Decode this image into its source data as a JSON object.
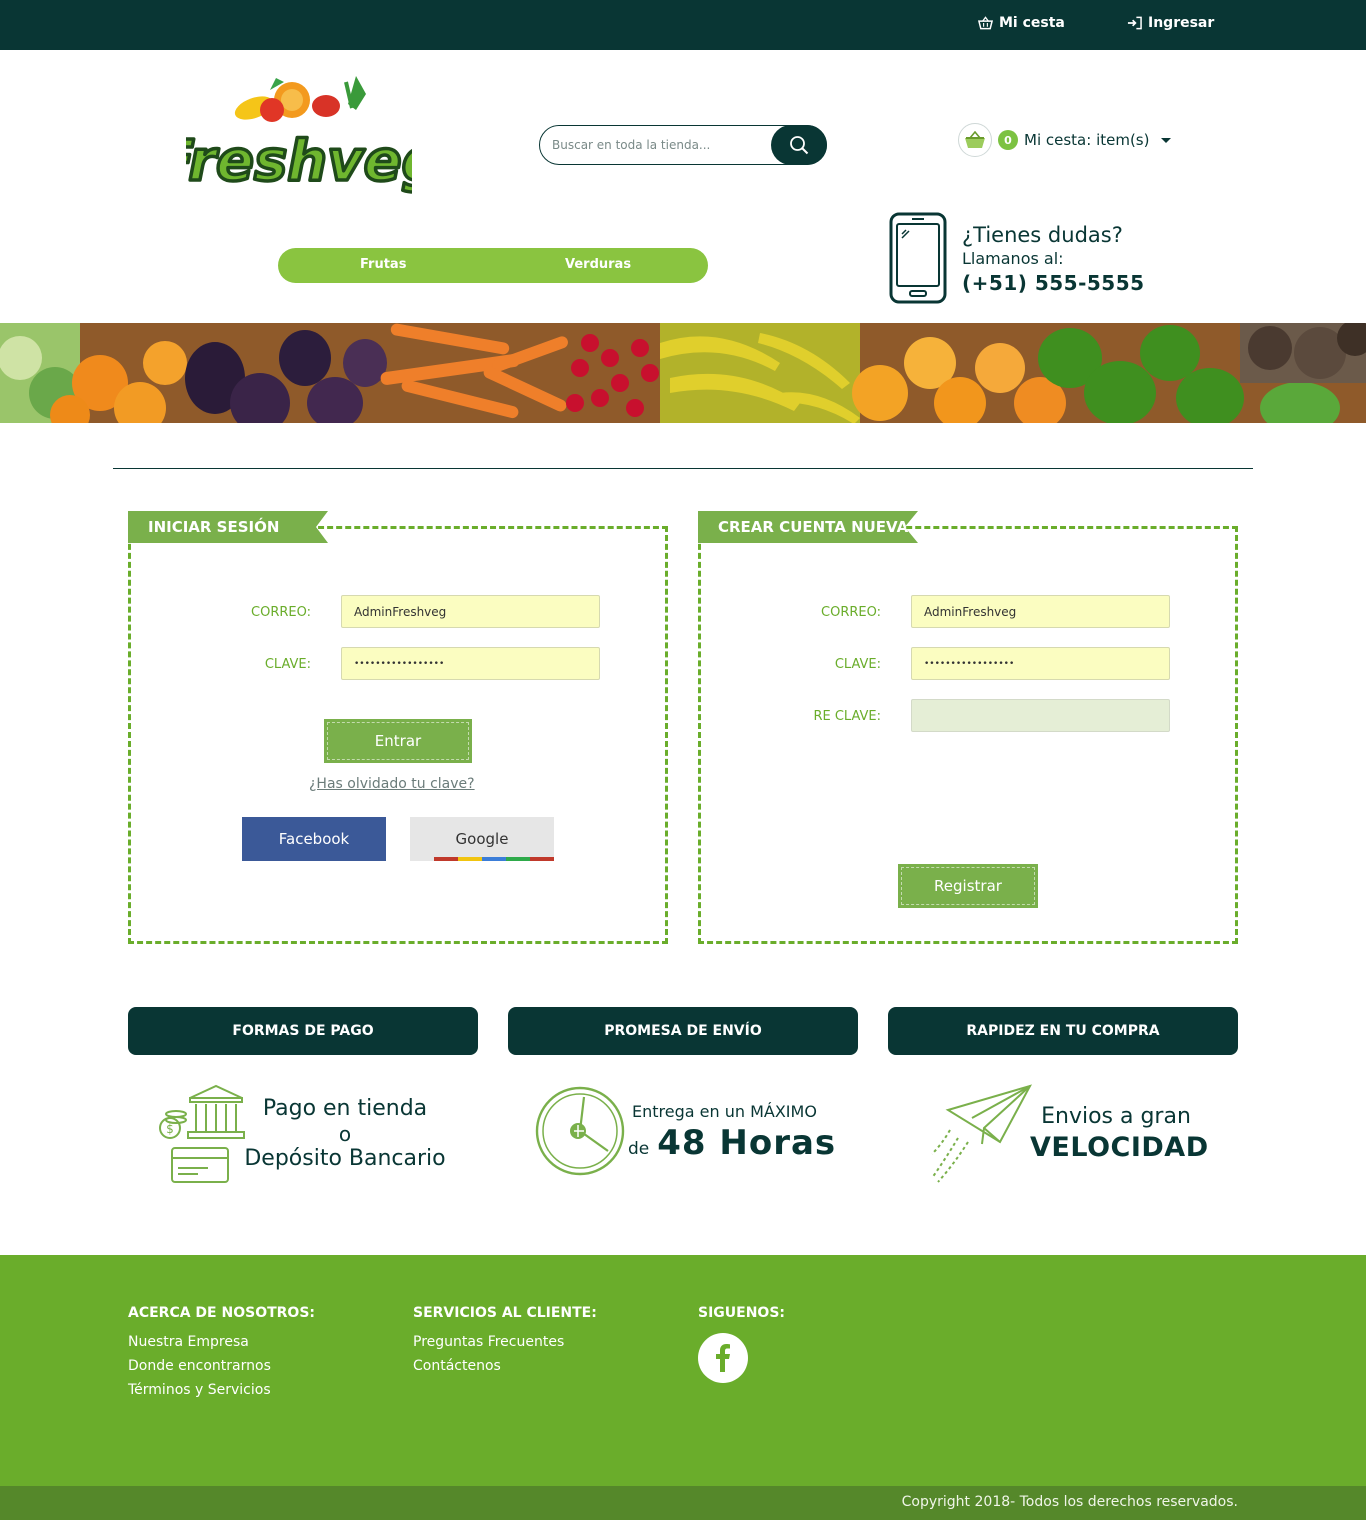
{
  "topbar": {
    "cart_link": "Mi cesta",
    "login_link": "Ingresar"
  },
  "header": {
    "logo_text": "Freshveg",
    "search_placeholder": "Buscar en toda la tienda...",
    "cart_count": "0",
    "cart_label": "Mi cesta: item(s)"
  },
  "nav": {
    "items": [
      "Frutas",
      "Verduras"
    ]
  },
  "help": {
    "question": "¿Tienes dudas?",
    "call": "Llamanos al:",
    "phone": "(+51) 555-5555"
  },
  "login": {
    "title": "INICIAR SESIÓN",
    "email_label": "CORREO:",
    "email_value": "AdminFreshveg",
    "password_label": "CLAVE:",
    "password_value": "•••••••••••••••••",
    "submit": "Entrar",
    "forgot": "¿Has olvidado tu clave?",
    "facebook": "Facebook",
    "google": "Google"
  },
  "register": {
    "title": "CREAR CUENTA NUEVA",
    "email_label": "CORREO:",
    "email_value": "AdminFreshveg",
    "password_label": "CLAVE:",
    "password_value": "•••••••••••••••••",
    "repassword_label": "RE CLAVE:",
    "repassword_value": "",
    "submit": "Registrar"
  },
  "features": [
    {
      "title": "FORMAS DE PAGO",
      "line1": "Pago en tienda",
      "line2": "o",
      "line3": "Depósito Bancario"
    },
    {
      "title": "PROMESA DE ENVÍO",
      "line1": "Entrega en un MÁXIMO",
      "line2": "de",
      "line3": "48 Horas"
    },
    {
      "title": "RAPIDEZ EN TU COMPRA",
      "line1": "Envios a gran",
      "line2": "VELOCIDAD"
    }
  ],
  "footer": {
    "about": {
      "title": "ACERCA DE NOSOTROS:",
      "links": [
        "Nuestra Empresa",
        "Donde encontrarnos",
        "Términos y Servicios"
      ]
    },
    "service": {
      "title": "SERVICIOS AL CLIENTE:",
      "links": [
        "Preguntas Frecuentes",
        "Contáctenos"
      ]
    },
    "follow": {
      "title": "SIGUENOS:"
    },
    "copyright": "Copyright 2018- Todos los derechos reservados."
  },
  "colors": {
    "dark": "#093634",
    "green": "#6aad2b",
    "light_green": "#8ac440",
    "facebook": "#3b5998"
  },
  "icons": [
    "basket-icon",
    "login-icon",
    "search-icon",
    "cart-basket-icon",
    "phone-icon",
    "bank-icon",
    "clock-icon",
    "paper-plane-icon",
    "facebook-icon"
  ]
}
